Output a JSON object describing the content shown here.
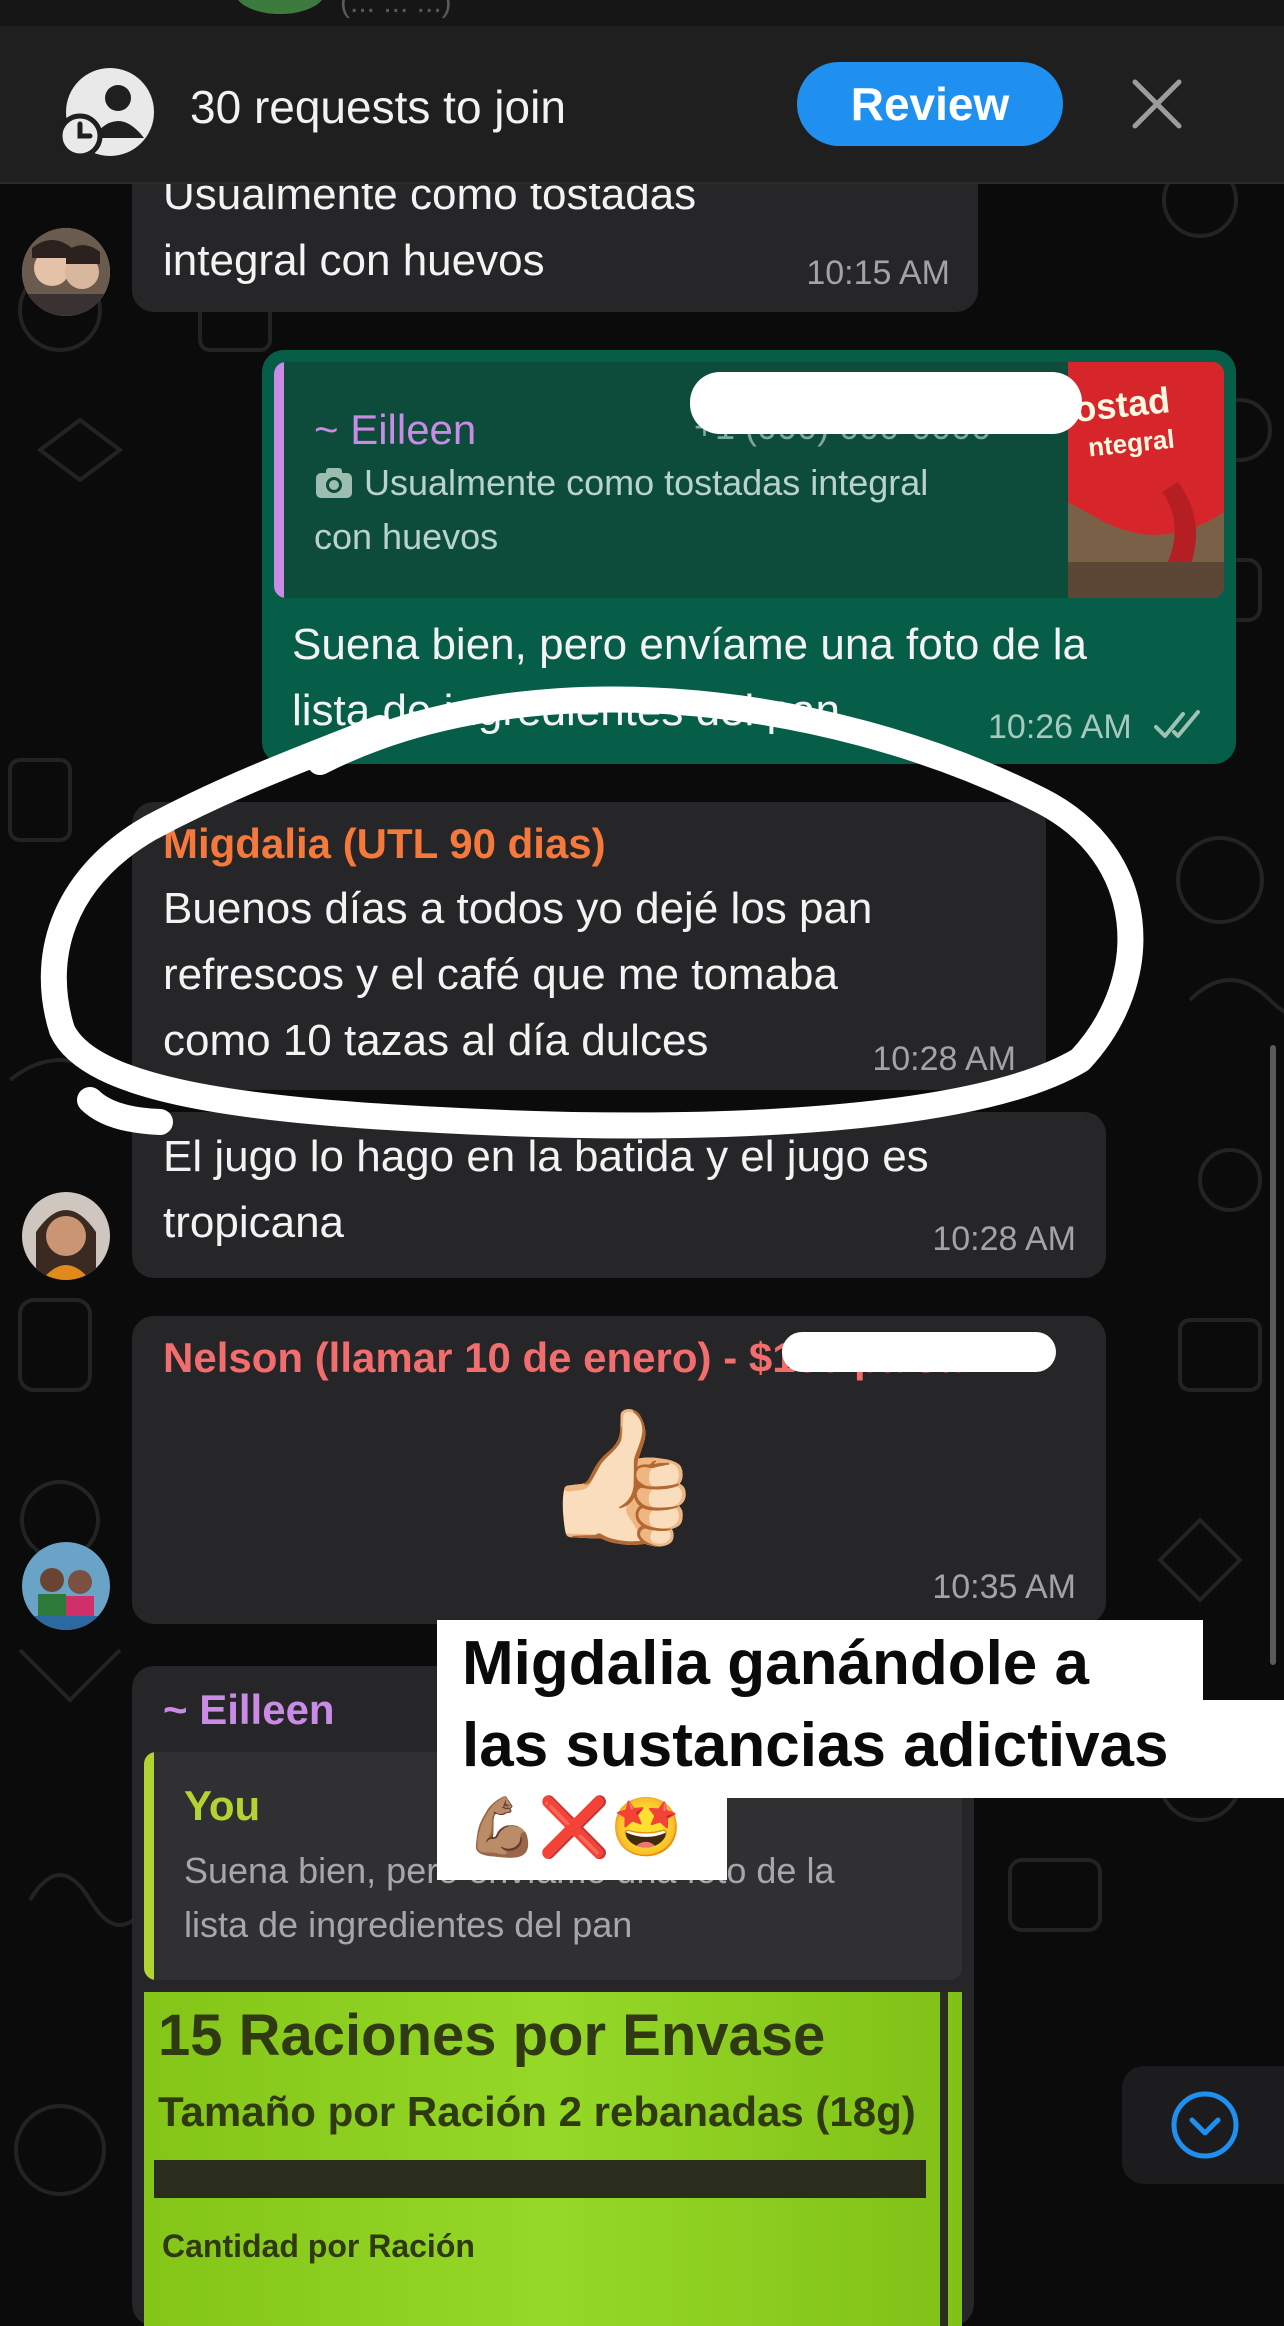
{
  "banner": {
    "requests_text": "30 requests to join",
    "review_label": "Review",
    "ghost_text": "(... ... ...)",
    "icons": {
      "group": "group-request-icon",
      "close": "close-icon"
    }
  },
  "messages": {
    "m1": {
      "text_line1": "Usualmente como tostadas",
      "text_line2": "integral con huevos",
      "time": "10:15 AM"
    },
    "m2": {
      "quote_sender": "~ Eilleen",
      "quote_phone": "+1 (000) 000-0000",
      "quote_line1": "Usualmente como tostadas integral",
      "quote_line2": "con huevos",
      "thumb_text1": "ostad",
      "thumb_text2": "ntegral",
      "text_line1": "Suena bien, pero envíame una foto de la",
      "text_line2": "lista de ingredientes del pan",
      "time": "10:26 AM"
    },
    "m3": {
      "sender": "Migdalia (UTL 90 dias)",
      "text_line1": "Buenos días a todos yo dejé los pan",
      "text_line2": "refrescos y el café que me tomaba",
      "text_line3": "como 10 tazas al día  dulces",
      "time": "10:28 AM"
    },
    "m4": {
      "text_line1": "El jugo lo hago en la batida y el jugo es",
      "text_line2": "tropicana",
      "time": "10:28 AM"
    },
    "m5": {
      "sender": "Nelson (llamar 10 de enero) - ",
      "sender_hidden": "$100 paisa...",
      "emoji": "👍🏻",
      "time": "10:35 AM"
    },
    "m6": {
      "sender": "~ Eilleen",
      "quote_sender": "You",
      "quote_line1": "Suena bien, pero envíame una foto de la",
      "quote_line2": "lista de ingredientes del pan",
      "label_line1": "15 Raciones por Envase",
      "label_line2": "Tamaño por Ración    2 rebanadas (18g)",
      "label_line3": "Cantidad por Ración"
    }
  },
  "caption": {
    "line1": "Migdalia ganándole a",
    "line2": "las sustancias adictivas",
    "line3": "💪🏽❌🤩"
  },
  "colors": {
    "migdalia": "#f4793b",
    "nelson": "#f26d6d",
    "eilleen": "#c98be6",
    "you": "#b2d432",
    "accent": "#1f8ff0"
  }
}
